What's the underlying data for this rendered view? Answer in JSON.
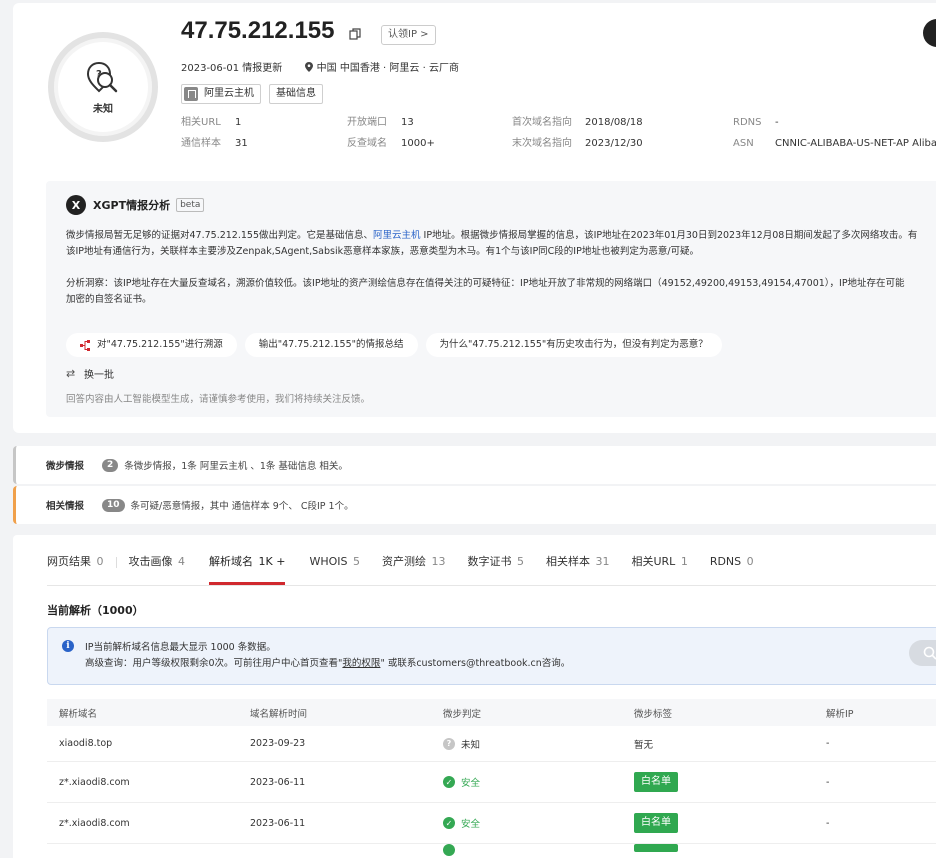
{
  "header": {
    "ip": "47.75.212.155",
    "verdict": "未知",
    "recognize_btn": "认领IP >",
    "update_date": "2023-06-01 情报更新",
    "location": "中国 中国香港",
    "provider": "阿里云 · 云厂商",
    "tags": [
      "阿里云主机",
      "基础信息"
    ]
  },
  "stats": {
    "col1": [
      {
        "k": "相关URL",
        "v": "1"
      },
      {
        "k": "通信样本",
        "v": "31"
      }
    ],
    "col2": [
      {
        "k": "开放端口",
        "v": "13"
      },
      {
        "k": "反查域名",
        "v": "1000+"
      }
    ],
    "col3": [
      {
        "k": "首次域名指向",
        "v": "2018/08/18"
      },
      {
        "k": "末次域名指向",
        "v": "2023/12/30"
      }
    ],
    "col4": [
      {
        "k": "RDNS",
        "v": "-"
      },
      {
        "k": "ASN",
        "v": "CNNIC-ALIBABA-US-NET-AP Alibaba"
      }
    ]
  },
  "xgpt": {
    "logo": "X",
    "title": "XGPT情报分析",
    "beta": "beta",
    "p1a_pre": "微步情报局暂无足够的证据对47.75.212.155做出判定。它是基础信息、",
    "p1a_link": "阿里云主机",
    "p1a_post": " IP地址。根据微步情报局掌握的信息，该IP地址在2023年01月30日到2023年12月08日期间发起了多次网络攻击。有",
    "p1b": "该IP地址有通信行为，关联样本主要涉及Zenpak,SAgent,Sabsik恶意样本家族，恶意类型为木马。有1个与该IP同C段的IP地址也被判定为恶意/可疑。",
    "p2a": "分析洞察：该IP地址存在大量反查域名，溯源价值较低。该IP地址的资产测绘信息存在值得关注的可疑特征：IP地址开放了非常规的网络端口（49152,49200,49153,49154,47001），IP地址存在可能",
    "p2b": "加密的自签名证书。",
    "questions": [
      "对\"47.75.212.155\"进行溯源",
      "输出\"47.75.212.155\"的情报总结",
      "为什么\"47.75.212.155\"有历史攻击行为，但没有判定为恶意？"
    ],
    "refresh": "换一批",
    "disclaimer": "回答内容由人工智能模型生成，请谨慎参考使用，我们将持续关注反馈。"
  },
  "intel_rows": [
    {
      "label": "微步情报",
      "count": "2",
      "text": "条微步情报，1条 阿里云主机 、1条 基础信息 相关。"
    },
    {
      "label": "相关情报",
      "count": "10",
      "text": "条可疑/恶意情报，其中 通信样本 9个、 C段IP 1个。"
    }
  ],
  "tabs": [
    {
      "label": "网页结果",
      "n": "0"
    },
    {
      "label": "攻击画像",
      "n": "4"
    },
    {
      "label": "解析域名",
      "n": "1K +"
    },
    {
      "label": "WHOIS",
      "n": "5"
    },
    {
      "label": "资产测绘",
      "n": "13"
    },
    {
      "label": "数字证书",
      "n": "5"
    },
    {
      "label": "相关样本",
      "n": "31"
    },
    {
      "label": "相关URL",
      "n": "1"
    },
    {
      "label": "RDNS",
      "n": "0"
    }
  ],
  "current": {
    "title": "当前解析（1000）",
    "notice_l1": "IP当前解析域名信息最大显示 1000 条数据。",
    "notice_l2_pre": "高级查询：用户等级权限剩余0次。可前往用户中心首页查看\"",
    "notice_l2_link": "我的权限",
    "notice_l2_post": "\" 或联系customers@threatbook.cn咨询。"
  },
  "table": {
    "headers": [
      "解析域名",
      "域名解析时间",
      "微步判定",
      "微步标签",
      "解析IP"
    ],
    "rows": [
      {
        "domain": "xiaodi8.top",
        "time": "2023-09-23",
        "judge": "未知",
        "tag": "暂无",
        "ip": "-"
      },
      {
        "domain": "z*.xiaodi8.com",
        "time": "2023-06-11",
        "judge": "安全",
        "tag": "白名单",
        "ip": "-"
      },
      {
        "domain": "z*.xiaodi8.com",
        "time": "2023-06-11",
        "judge": "安全",
        "tag": "白名单",
        "ip": "-"
      }
    ]
  }
}
